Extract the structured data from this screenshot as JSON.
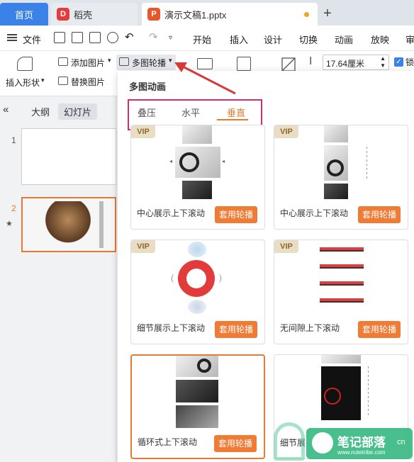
{
  "tabs": {
    "home": "首页",
    "daoke": "稻壳",
    "doc": "演示文稿1.pptx",
    "daoke_logo": "D",
    "ppt_logo": "P"
  },
  "menu": {
    "file": "文件",
    "items": [
      "开始",
      "插入",
      "设计",
      "切换",
      "动画",
      "放映",
      "审"
    ]
  },
  "ribbon": {
    "insert_shape": "插入形状",
    "add_image": "添加图片",
    "replace_image": "替换图片",
    "carousel": "多图轮播",
    "size_value": "17.64厘米",
    "lock_label": "锁"
  },
  "leftpane": {
    "tab_outline": "大纲",
    "tab_slides": "幻灯片",
    "slide1_num": "1",
    "slide2_num": "2"
  },
  "panel": {
    "title": "多图动画",
    "modes": [
      "叠压",
      "水平",
      "垂直"
    ],
    "active_mode": "垂直",
    "apply_label": "套用轮播",
    "vip_label": "VIP",
    "cards": [
      {
        "label": "中心展示上下滚动",
        "vip": true
      },
      {
        "label": "中心展示上下滚动",
        "vip": true
      },
      {
        "label": "细节展示上下滚动",
        "vip": true
      },
      {
        "label": "无间隙上下滚动",
        "vip": true
      },
      {
        "label": "循环式上下滚动",
        "vip": false
      },
      {
        "label": "细节展",
        "vip": false
      }
    ]
  },
  "watermark": {
    "main": "笔记部落",
    "sub": "www.notetribe.com",
    "url_suffix": "cn"
  },
  "colors": {
    "accent": "#ef7b35",
    "home_tab": "#3b82e8",
    "highlight_box": "#c9307a",
    "arrow": "#d63a3a"
  }
}
